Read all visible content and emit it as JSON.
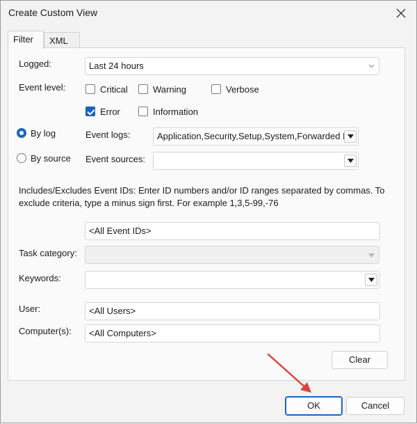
{
  "window": {
    "title": "Create Custom View"
  },
  "tabs": [
    {
      "label": "Filter"
    },
    {
      "label": "XML"
    }
  ],
  "filter": {
    "logged": {
      "label": "Logged:",
      "value": "Last 24 hours"
    },
    "event_level": {
      "label": "Event level:",
      "options": [
        {
          "label": "Critical",
          "checked": false
        },
        {
          "label": "Warning",
          "checked": false
        },
        {
          "label": "Verbose",
          "checked": false
        },
        {
          "label": "Error",
          "checked": true
        },
        {
          "label": "Information",
          "checked": false
        }
      ]
    },
    "by_log": {
      "label": "By log",
      "selected": true
    },
    "by_source": {
      "label": "By source",
      "selected": false
    },
    "event_logs": {
      "label": "Event logs:",
      "value": "Application,Security,Setup,System,Forwarded Ev"
    },
    "event_sources": {
      "label": "Event sources:",
      "value": ""
    },
    "description": "Includes/Excludes Event IDs: Enter ID numbers and/or ID ranges separated by commas. To exclude criteria, type a minus sign first. For example 1,3,5-99,-76",
    "event_ids": {
      "value": "<All Event IDs>"
    },
    "task_category": {
      "label": "Task category:",
      "value": ""
    },
    "keywords": {
      "label": "Keywords:",
      "value": ""
    },
    "user": {
      "label": "User:",
      "value": "<All Users>"
    },
    "computer": {
      "label": "Computer(s):",
      "value": "<All Computers>"
    },
    "clear_label": "Clear"
  },
  "footer": {
    "ok_label": "OK",
    "cancel_label": "Cancel"
  },
  "colors": {
    "accent": "#1a63bf",
    "annotation_arrow": "#e04040"
  },
  "icons": {
    "close": "close-icon",
    "dropdown": "chevron-down-icon",
    "annotation": "red-arrow-annotation"
  }
}
